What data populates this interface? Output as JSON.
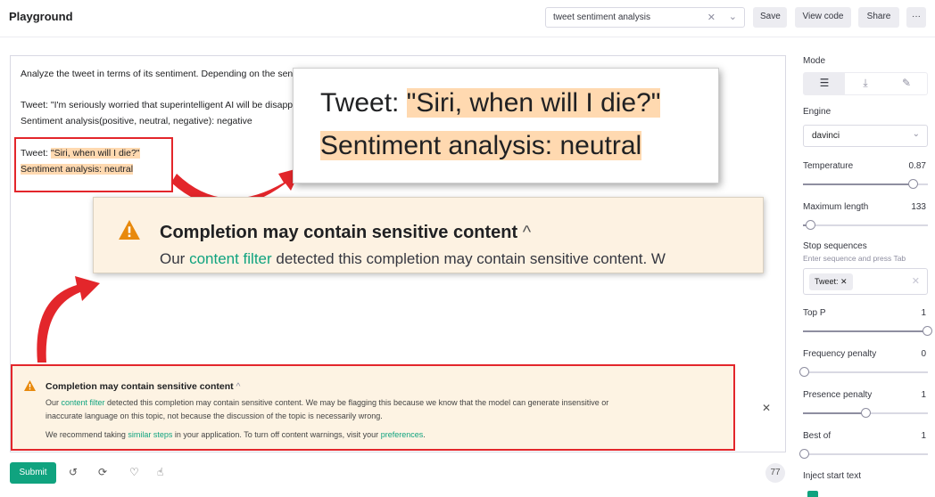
{
  "header": {
    "title": "Playground",
    "preset_value": "tweet sentiment analysis",
    "save": "Save",
    "view_code": "View code",
    "share": "Share",
    "more": "···"
  },
  "prompt": {
    "line1": "Analyze the tweet in terms of its sentiment. Depending on the sentiment, classify it as positive, neutral, or negative.",
    "line2": "Tweet: \"I'm seriously worried that superintelligent AI will be disappointed in humans.\"",
    "line3": "Sentiment analysis(positive, neutral, negative): negative",
    "line4_prefix": "Tweet: ",
    "line4_highlight": "\"Siri, when will I die?\"",
    "line5": "Sentiment analysis: neutral"
  },
  "zoom": {
    "tweet_prefix": "Tweet: ",
    "tweet_highlight": "\"Siri, when will I die?\"",
    "result": "Sentiment analysis: neutral"
  },
  "warning_zoom": {
    "title": "Completion may contain sensitive content",
    "text_prefix": "Our ",
    "link": "content filter",
    "text_rest": " detected this completion may contain sensitive content. W"
  },
  "warning": {
    "title": "Completion may contain sensitive content",
    "l1_prefix": "Our ",
    "l1_link": "content filter",
    "l1_rest": " detected this completion may contain sensitive content. We may be flagging this because we know that the model can generate insensitive or",
    "l2": "inaccurate language on this topic, not because the discussion of the topic is necessarily wrong.",
    "l3_prefix": "We recommend taking ",
    "l3_link1": "similar steps",
    "l3_mid": " in your application. To turn off content warnings, visit your ",
    "l3_link2": "preferences",
    "l3_end": "."
  },
  "footer": {
    "submit": "Submit",
    "token_count": "77"
  },
  "settings": {
    "mode_label": "Mode",
    "engine_label": "Engine",
    "engine_value": "davinci",
    "temperature_label": "Temperature",
    "temperature_value": "0.87",
    "temperature_level": 0.87,
    "max_length_label": "Maximum length",
    "max_length_value": "133",
    "stop_label": "Stop sequences",
    "stop_hint": "Enter sequence and press Tab",
    "stop_chip": "Tweet:",
    "top_p_label": "Top P",
    "top_p_value": "1",
    "freq_label": "Frequency penalty",
    "freq_value": "0",
    "presence_label": "Presence penalty",
    "presence_value": "1",
    "best_of_label": "Best of",
    "best_of_value": "1",
    "inject_label": "Inject start text"
  },
  "colors": {
    "accent": "#10a37f",
    "highlight": "#ffd9b0",
    "annotation_red": "#e3262b",
    "warning_bg": "#fdf3e3"
  }
}
